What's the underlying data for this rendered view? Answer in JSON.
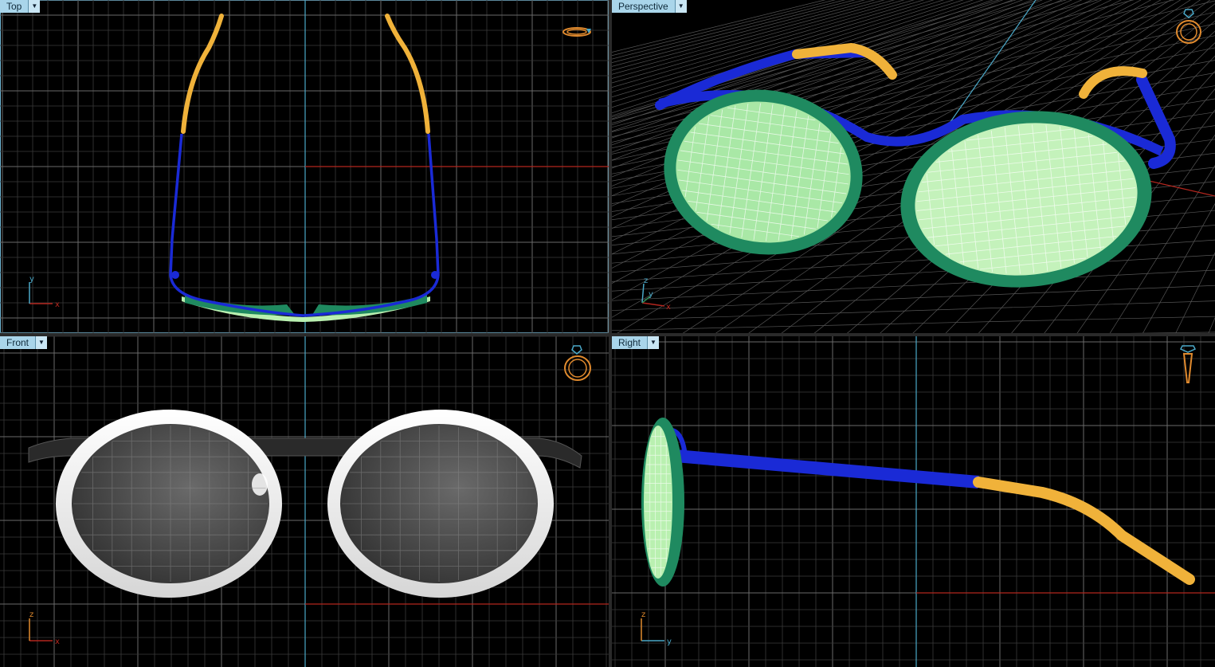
{
  "viewports": {
    "top": {
      "label": "Top"
    },
    "perspective": {
      "label": "Perspective"
    },
    "front": {
      "label": "Front"
    },
    "right": {
      "label": "Right"
    }
  },
  "axes": {
    "top": {
      "h": "x",
      "v": "y"
    },
    "perspective": {
      "h": "x",
      "v": "z",
      "d": "y"
    },
    "front": {
      "h": "x",
      "v": "z"
    },
    "right": {
      "h": "y",
      "v": "z"
    }
  },
  "colors": {
    "background": "#000000",
    "grid": "#3a3a3a",
    "grid_major": "#6a6a6a",
    "axis_x": "#b3261e",
    "axis_y": "#4aa8c8",
    "frame_blue": "#1a2ad6",
    "temple_tip": "#f0b23a",
    "rim_green": "#1f8a60",
    "lens_green": "#b9f0b0",
    "label_bg": "#a9d5ea",
    "gizmo": "#e08a2e"
  },
  "icons": [
    "ring-gizmo-icon",
    "dropdown-arrow-icon",
    "axis-triad-icon"
  ]
}
